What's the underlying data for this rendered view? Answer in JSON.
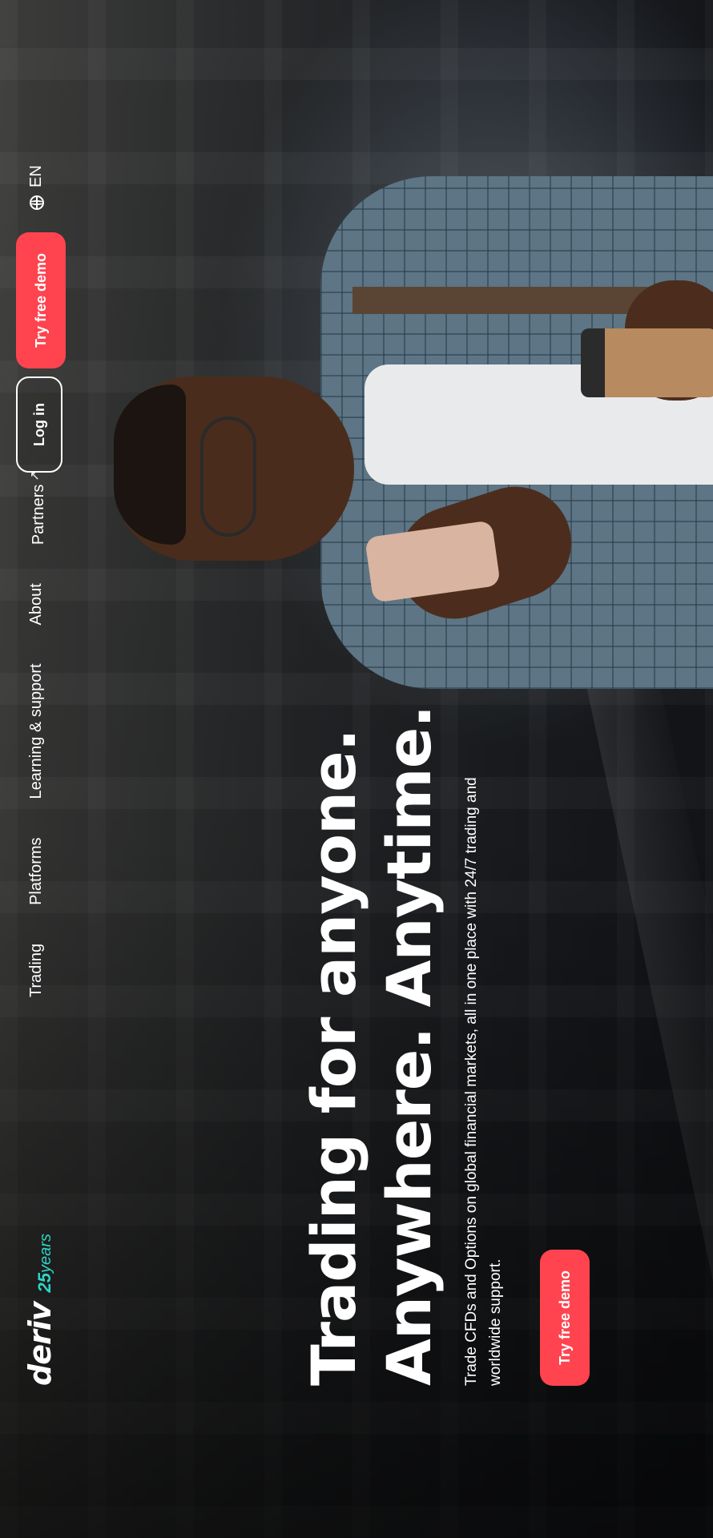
{
  "colors": {
    "brand_red": "#ff444f",
    "years_accent": "#2dd4c6",
    "text": "#ffffff"
  },
  "header": {
    "logo_text": "deriv",
    "years_number": "25",
    "years_word": "years",
    "nav": [
      {
        "label": "Trading"
      },
      {
        "label": "Platforms"
      },
      {
        "label": "Learning & support"
      },
      {
        "label": "About"
      },
      {
        "label": "Partners",
        "icon": "external-arrow-icon",
        "arrow": "↗"
      }
    ],
    "login_label": "Log in",
    "demo_label": "Try free demo",
    "language": "EN",
    "language_icon": "globe-icon"
  },
  "hero": {
    "title_line1": "Trading for anyone.",
    "title_line2": "Anywhere. Anytime.",
    "description": "Trade CFDs and Options on global financial markets, all in one place with 24/7 trading and worldwide support.",
    "cta_label": "Try free demo"
  }
}
